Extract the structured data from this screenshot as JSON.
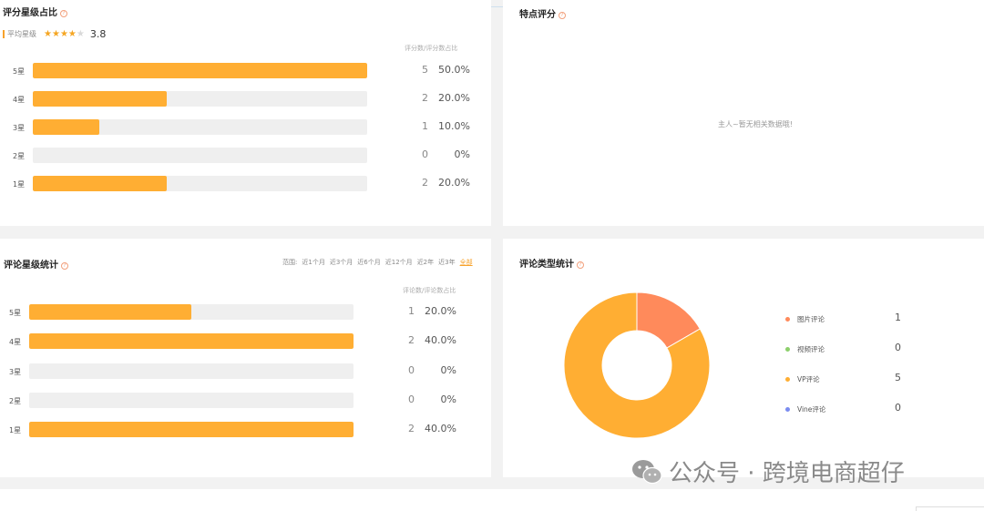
{
  "rating_share": {
    "title": "评分星级占比",
    "avg_label": "平均星级",
    "stars_filled": 4,
    "stars_total": 5,
    "avg_score": "3.8",
    "col_header": "评分数/评分数占比",
    "rows": [
      {
        "label": "5星",
        "count": "5",
        "pct": "50.0%",
        "fraction": 1.0
      },
      {
        "label": "4星",
        "count": "2",
        "pct": "20.0%",
        "fraction": 0.4
      },
      {
        "label": "3星",
        "count": "1",
        "pct": "10.0%",
        "fraction": 0.2
      },
      {
        "label": "2星",
        "count": "0",
        "pct": "0%",
        "fraction": 0
      },
      {
        "label": "1星",
        "count": "2",
        "pct": "20.0%",
        "fraction": 0.4
      }
    ]
  },
  "feature_score": {
    "title": "特点评分",
    "empty_text": "主人~暂无相关数据哦!"
  },
  "review_stats": {
    "title": "评论星级统计",
    "range_label": "范围:",
    "ranges": [
      "近1个月",
      "近3个月",
      "近6个月",
      "近12个月",
      "近2年",
      "近3年",
      "全部"
    ],
    "active_range": "全部",
    "col_header": "评论数/评论数占比",
    "rows": [
      {
        "label": "5星",
        "count": "1",
        "pct": "20.0%",
        "fraction": 0.5
      },
      {
        "label": "4星",
        "count": "2",
        "pct": "40.0%",
        "fraction": 1.0
      },
      {
        "label": "3星",
        "count": "0",
        "pct": "0%",
        "fraction": 0
      },
      {
        "label": "2星",
        "count": "0",
        "pct": "0%",
        "fraction": 0
      },
      {
        "label": "1星",
        "count": "2",
        "pct": "40.0%",
        "fraction": 1.0
      }
    ]
  },
  "review_type": {
    "title": "评论类型统计",
    "items": [
      {
        "name": "图片评论",
        "value": "1",
        "color": "#ff8a5b"
      },
      {
        "name": "视频评论",
        "value": "0",
        "color": "#8ccf6b"
      },
      {
        "name": "VP评论",
        "value": "5",
        "color": "#ffae33"
      },
      {
        "name": "Vine评论",
        "value": "0",
        "color": "#7b8cf0"
      }
    ]
  },
  "watermark": {
    "text": "公众号 · 跨境电商超仔"
  },
  "chart_data": {
    "type": "pie",
    "categories": [
      "图片评论",
      "视频评论",
      "VP评论",
      "Vine评论"
    ],
    "values": [
      1,
      0,
      5,
      0
    ],
    "colors": [
      "#ff8a5b",
      "#8ccf6b",
      "#ffae33",
      "#7b8cf0"
    ],
    "donut": true,
    "legend": "right"
  }
}
